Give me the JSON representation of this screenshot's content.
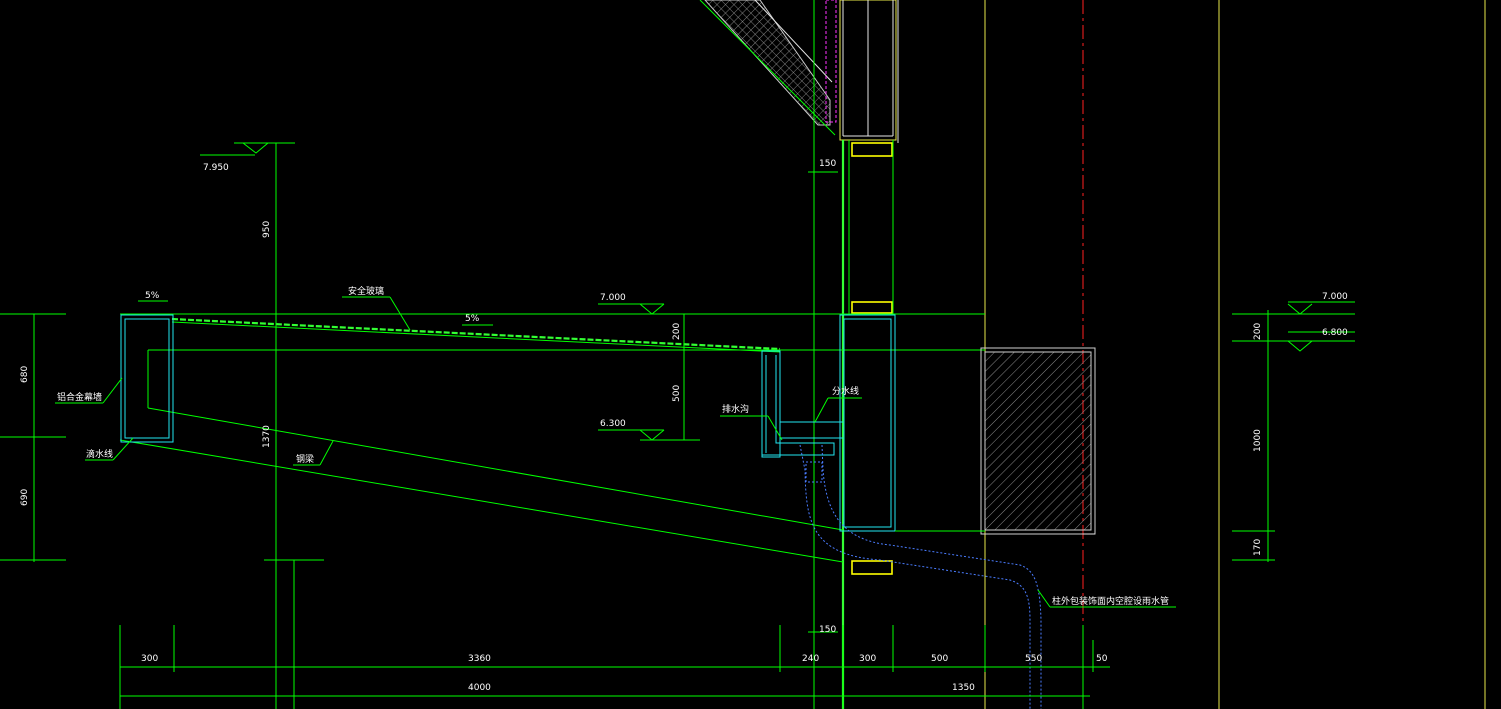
{
  "labels": {
    "elev_7950": "7.950",
    "elev_7000_left": "7.000",
    "elev_6300": "6.300",
    "elev_7000_right": "7.000",
    "elev_6800": "6.800",
    "slope_a": "5%",
    "slope_b": "5%",
    "safety_glass": "安全玻璃",
    "aluminum_curtain_wall": "铝合金幕墙",
    "drip_line": "滴水线",
    "steel_beam": "钢梁",
    "drain_gutter": "排水沟",
    "divide_water_line": "分水线",
    "downpipe_note": "柱外包装饰面内空腔设雨水管"
  },
  "dims": {
    "d950": "950",
    "d1370": "1370",
    "d200": "200",
    "d500": "500",
    "d680": "680",
    "d690": "690",
    "d150_top": "150",
    "d150_bot": "150",
    "d200_r": "200",
    "d1000_r": "1000",
    "d170_r": "170",
    "d300_a": "300",
    "d3360": "3360",
    "d240": "240",
    "d300_b": "300",
    "d500_b": "500",
    "d550": "550",
    "d50": "50",
    "d4000": "4000",
    "d1350": "1350"
  }
}
